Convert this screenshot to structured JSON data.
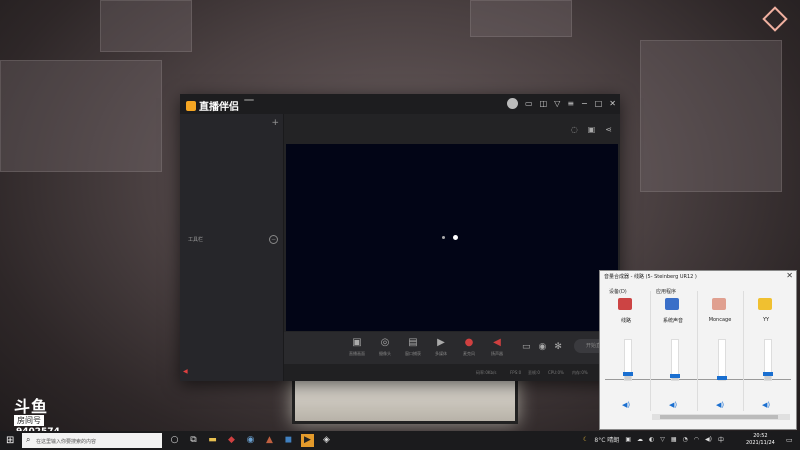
{
  "app": {
    "title": "直播伴侣",
    "version": "",
    "left_panel": {
      "add_symbol": "+",
      "item_label": "工具栏"
    },
    "tools": [
      {
        "name": "tool-screen-capture",
        "icon": "▣",
        "label": "直播画面"
      },
      {
        "name": "tool-camera",
        "icon": "◎",
        "label": "摄像头"
      },
      {
        "name": "tool-window",
        "icon": "▤",
        "label": "窗口捕获"
      },
      {
        "name": "tool-video",
        "icon": "▶",
        "label": "多媒体"
      },
      {
        "name": "tool-mic",
        "icon": "●",
        "label": "麦克风"
      },
      {
        "name": "tool-speaker",
        "icon": "◀",
        "label": "扬声器"
      }
    ],
    "start_button": "开始直播",
    "status": [
      {
        "label": "码率:0Kb/s"
      },
      {
        "label": "FPS:0"
      },
      {
        "label": "丢帧:0"
      },
      {
        "label": "CPU:0%"
      },
      {
        "label": "内存:0%"
      }
    ]
  },
  "mixer": {
    "title": "音量合成器 - 线路 (5- Steinberg UR12 )",
    "close": "✕",
    "device_label": "设备(D)",
    "apps_label": "应用程序",
    "channels": [
      {
        "name": "线路",
        "level": 0.15,
        "color": "#c44"
      },
      {
        "name": "系统声音",
        "level": 0.1,
        "color": "#3a6fc8"
      },
      {
        "name": "Moncage",
        "level": 0.05,
        "color": "#e0a090"
      },
      {
        "name": "YY",
        "level": 0.15,
        "color": "#f0c030"
      }
    ]
  },
  "watermark": {
    "brand": "斗鱼",
    "room_label": "房间号",
    "room_number": "9402574"
  },
  "taskbar": {
    "search_placeholder": "在这里输入你要搜索的内容",
    "weather": "8°C 晴朗",
    "time": "20:52",
    "date": "2021/11/24"
  }
}
